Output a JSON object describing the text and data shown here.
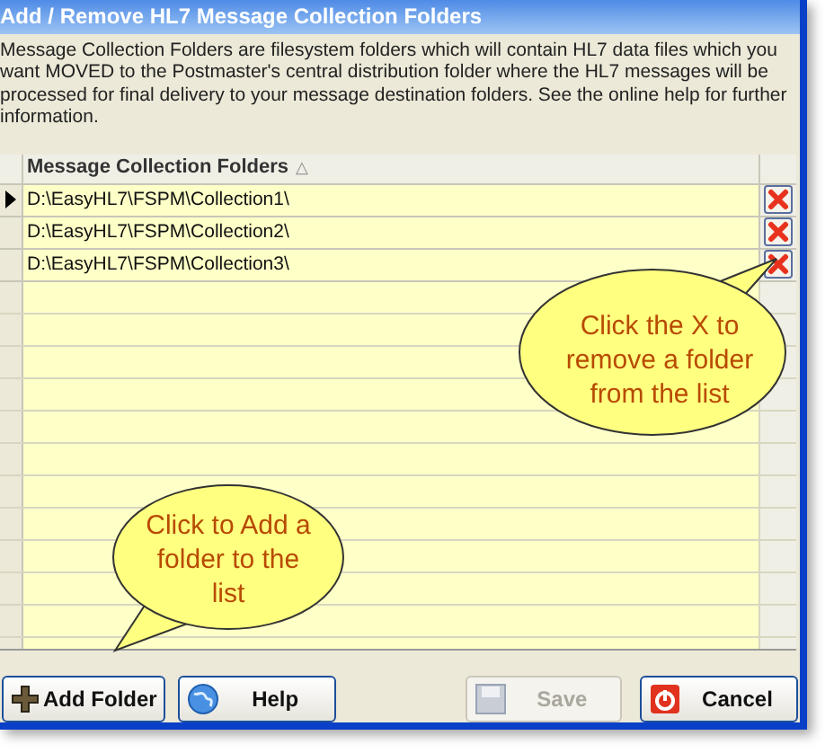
{
  "window": {
    "title": "Add / Remove HL7 Message Collection Folders"
  },
  "description": "Message Collection Folders are filesystem folders which will contain HL7 data files which you want MOVED to the Postmaster's central distribution folder where the HL7 messages will be processed for final delivery to your message destination folders. See the online help for further information.",
  "table": {
    "column": "Message Collection Folders",
    "sort_indicator": "△",
    "rows": [
      {
        "path": "D:\\EasyHL7\\FSPM\\Collection1\\",
        "selected": true
      },
      {
        "path": "D:\\EasyHL7\\FSPM\\Collection2\\",
        "selected": false
      },
      {
        "path": "D:\\EasyHL7\\FSPM\\Collection3\\",
        "selected": false
      }
    ]
  },
  "callouts": [
    {
      "text": "Click the X to remove a folder from the list",
      "kind": "remove"
    },
    {
      "text": "Click to Add a folder to the list",
      "kind": "add"
    }
  ],
  "buttons": [
    {
      "label": "Add Folder",
      "kind": "add",
      "disabled": false
    },
    {
      "label": "Help",
      "kind": "help",
      "disabled": false
    },
    {
      "label": "Save",
      "kind": "save",
      "disabled": true
    },
    {
      "label": "Cancel",
      "kind": "cancel",
      "disabled": false
    }
  ]
}
